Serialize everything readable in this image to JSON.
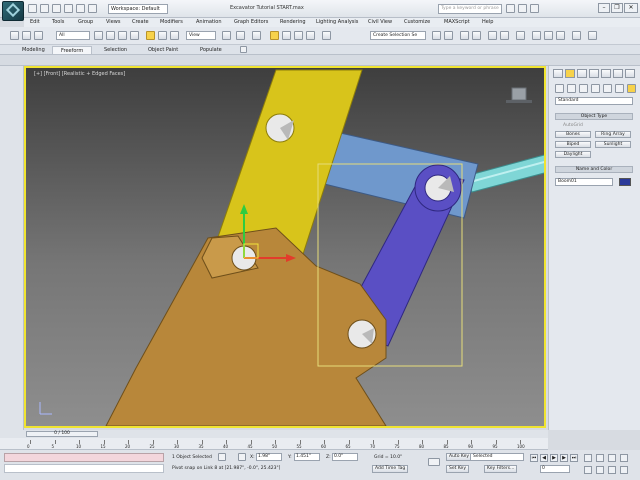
{
  "titlebar": {
    "workspace": "Workspace: Default",
    "window_title": "Excavator Tutorial START.max",
    "search_placeholder": "Type a keyword or phrase",
    "buttons": [
      "–",
      "❐",
      "✕"
    ]
  },
  "menu": [
    "Edit",
    "Tools",
    "Group",
    "Views",
    "Create",
    "Modifiers",
    "Animation",
    "Graph Editors",
    "Rendering",
    "Lighting Analysis",
    "Civil View",
    "Customize",
    "MAXScript",
    "Help"
  ],
  "toolbar": {
    "selection_filter": "All",
    "reference_coord": "View",
    "named_selection": "Create Selection Se"
  },
  "ribbon_tabs": [
    "Modeling",
    "Freeform",
    "Selection",
    "Object Paint",
    "Populate"
  ],
  "ribbon_selected": "Freeform",
  "viewport": {
    "label": "[+] [Front] [Realistic + Edged Faces]"
  },
  "command_panel": {
    "category_dropdown": "Standard",
    "object_type_header": "Object Type",
    "autogrid": "AutoGrid",
    "buttons": [
      "Bones",
      "Ring Array",
      "Biped",
      "Sunlight",
      "Daylight"
    ],
    "name_color_header": "Name and Color",
    "name_value": "Boom01",
    "swatch_color": "#2b3a9a"
  },
  "timeline": {
    "frame_label": "0 / 100",
    "ticks": [
      "0",
      "5",
      "10",
      "15",
      "20",
      "25",
      "30",
      "35",
      "40",
      "45",
      "50",
      "55",
      "60",
      "65",
      "70",
      "75",
      "80",
      "85",
      "90",
      "95",
      "100"
    ]
  },
  "status": {
    "selected": "1 Object Selected",
    "prompt": "Pivot snap on Link 8 at [21.987\", -0.0\", 25.423\"]",
    "x_label": "X:",
    "x_value": "1.98\"",
    "y_label": "Y:",
    "y_value": "1.451\"",
    "z_label": "Z:",
    "z_value": "0.0\"",
    "grid": "Grid = 10.0\"",
    "add_time_tag": "Add Time Tag",
    "auto_key": "Auto Key",
    "auto_key_sel": "Selected",
    "set_key": "Set Key",
    "key_filters": "Key Filters...",
    "frame": "0"
  },
  "colors": {
    "accent": "#f0e430",
    "boom": "#d8c41b",
    "stick": "#5a4fc4",
    "link": "#6f98cc",
    "bucket": "#b8873a",
    "cylinder": "#7fd6d6"
  }
}
